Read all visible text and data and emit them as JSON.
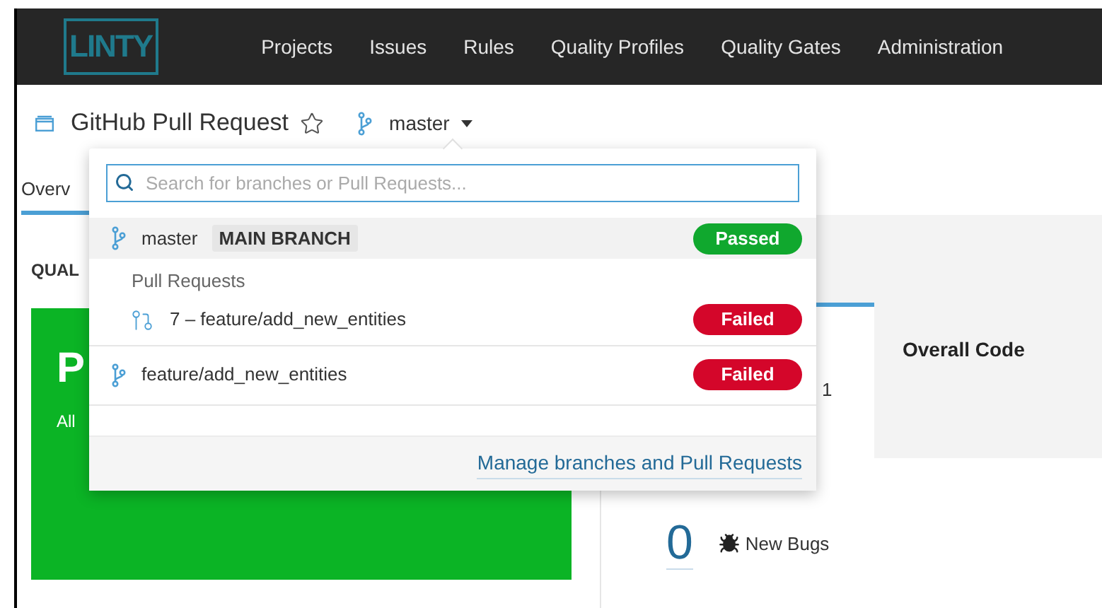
{
  "nav": {
    "logo": "LINTY",
    "items": [
      {
        "label": "Projects"
      },
      {
        "label": "Issues"
      },
      {
        "label": "Rules"
      },
      {
        "label": "Quality Profiles"
      },
      {
        "label": "Quality Gates"
      },
      {
        "label": "Administration"
      }
    ]
  },
  "header": {
    "project": "GitHub Pull Request",
    "favorite": false,
    "branch": "master"
  },
  "tabs": [
    {
      "label": "Overv",
      "selected": true
    }
  ],
  "quality_gate": {
    "heading": "QUAL",
    "status": "P",
    "message": "All",
    "kind": "passed"
  },
  "metrics": {
    "value_fragment": "1",
    "overall_heading": "Overall Code",
    "new_bugs_count": "0",
    "new_bugs_label": "New Bugs"
  },
  "branch_menu": {
    "search": {
      "placeholder": "Search for branches or Pull Requests..."
    },
    "main": {
      "name": "master",
      "badge": "MAIN BRANCH",
      "selected": true,
      "status": {
        "label": "Passed",
        "kind": "passed"
      }
    },
    "pull_requests_heading": "Pull Requests",
    "pull_requests": [
      {
        "label": "7 – feature/add_new_entities",
        "selected": false,
        "status": {
          "label": "Failed",
          "kind": "failed"
        }
      }
    ],
    "branches": [
      {
        "name": "feature/add_new_entities",
        "selected": false,
        "status": {
          "label": "Failed",
          "kind": "failed"
        }
      }
    ],
    "manage_link": "Manage branches and Pull Requests"
  }
}
